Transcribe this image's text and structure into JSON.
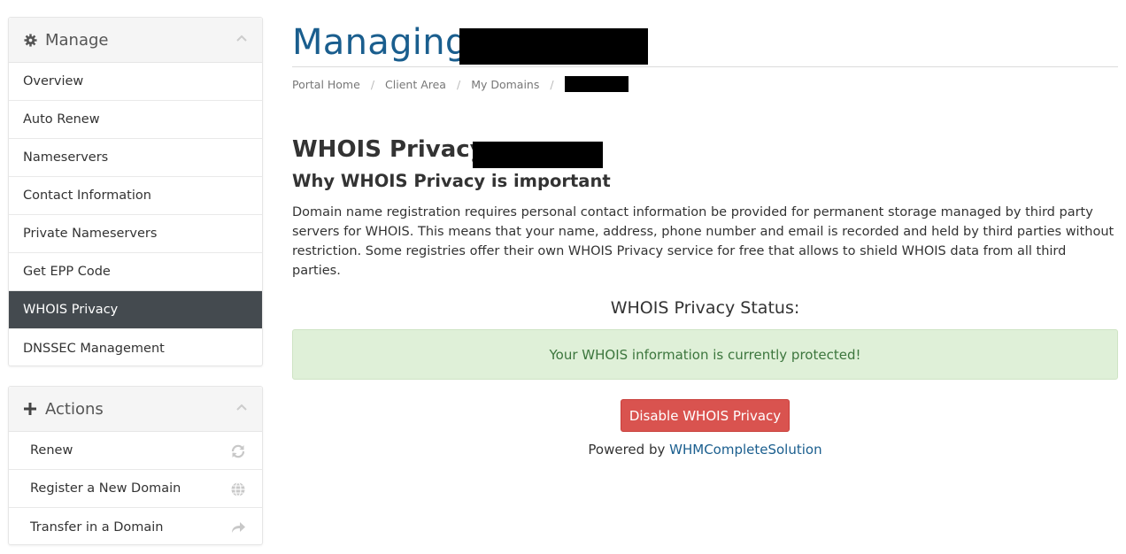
{
  "sidebar": {
    "manage": {
      "title": "Manage",
      "icon": "gear-icon",
      "items": [
        {
          "label": "Overview"
        },
        {
          "label": "Auto Renew"
        },
        {
          "label": "Nameservers"
        },
        {
          "label": "Contact Information"
        },
        {
          "label": "Private Nameservers"
        },
        {
          "label": "Get EPP Code"
        },
        {
          "label": "WHOIS Privacy",
          "active": true
        },
        {
          "label": "DNSSEC Management"
        }
      ]
    },
    "actions": {
      "title": "Actions",
      "icon": "plus-icon",
      "items": [
        {
          "label": "Renew",
          "icon": "refresh-icon"
        },
        {
          "label": "Register a New Domain",
          "icon": "globe-icon"
        },
        {
          "label": "Transfer in a Domain",
          "icon": "share-arrow-icon"
        }
      ]
    }
  },
  "main": {
    "title": "Managing",
    "breadcrumb": [
      "Portal Home",
      "Client Area",
      "My Domains"
    ],
    "section_title": "WHOIS Privacy -",
    "why_title": "Why WHOIS Privacy is important",
    "description": "Domain name registration requires personal contact information be provided for permanent storage managed by third party servers for WHOIS. This means that your name, address, phone number and email is recorded and held by third parties without restriction. Some registries offer their own WHOIS Privacy service for free that allows to shield WHOIS data from all third parties.",
    "status_label": "WHOIS Privacy Status:",
    "status_message": "Your WHOIS information is currently protected!",
    "disable_button": "Disable WHOIS Privacy",
    "powered_by_prefix": "Powered by",
    "powered_by_link": "WHMCompleteSolution"
  },
  "colors": {
    "title_blue": "#1a5e8e",
    "active_menu_bg": "#444a4f",
    "alert_bg": "#dff0d8",
    "alert_text": "#3c763d",
    "danger_button": "#d9534f"
  }
}
